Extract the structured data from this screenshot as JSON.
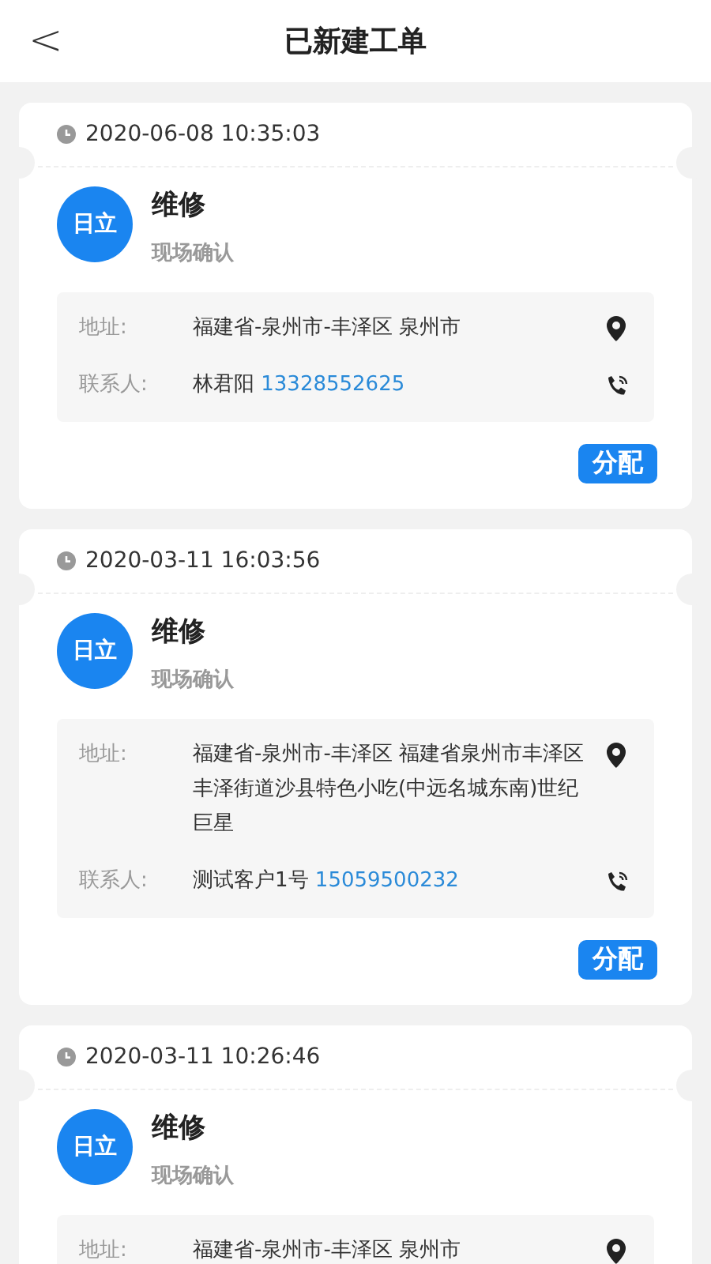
{
  "header": {
    "title": "已新建工单",
    "back": "<"
  },
  "orders": [
    {
      "time": "2020-06-08 10:35:03",
      "avatar": "日立",
      "type": "维修",
      "status": "现场确认",
      "address_label": "地址:",
      "address": "福建省-泉州市-丰泽区 泉州市",
      "contact_label": "联系人:",
      "contact_name": "林君阳",
      "phone": "13328552625",
      "action": "分配"
    },
    {
      "time": "2020-03-11 16:03:56",
      "avatar": "日立",
      "type": "维修",
      "status": "现场确认",
      "address_label": "地址:",
      "address": "福建省-泉州市-丰泽区 福建省泉州市丰泽区丰泽街道沙县特色小吃(中远名城东南)世纪巨星",
      "contact_label": "联系人:",
      "contact_name": "测试客户1号",
      "phone": "15059500232",
      "action": "分配"
    },
    {
      "time": "2020-03-11 10:26:46",
      "avatar": "日立",
      "type": "维修",
      "status": "现场确认",
      "address_label": "地址:",
      "address": "福建省-泉州市-丰泽区 泉州市"
    }
  ]
}
